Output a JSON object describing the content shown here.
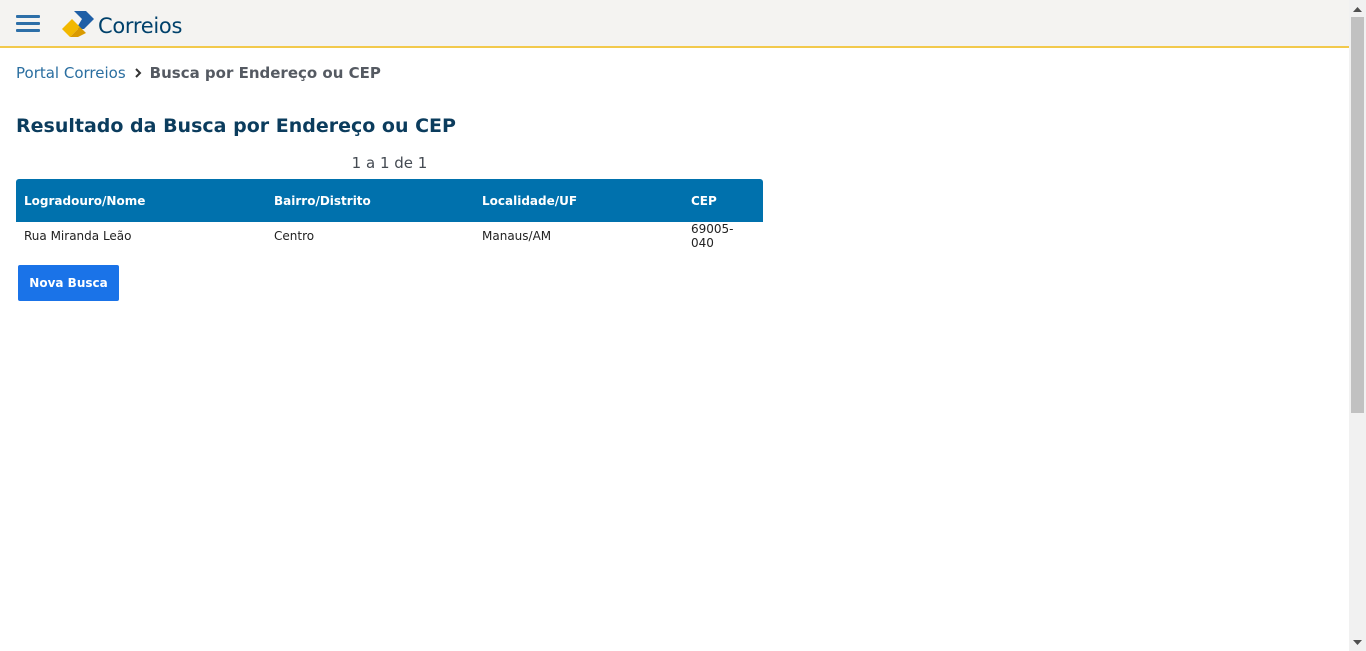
{
  "header": {
    "menu_icon": "hamburger-menu-icon",
    "logo_text": "Correios",
    "logo_icon": "correios-logo-mark",
    "accent_color": "#f2c94c",
    "brand_color": "#00416b"
  },
  "breadcrumb": {
    "home_label": "Portal Correios",
    "separator_icon": "chevron-right-icon",
    "current_label": "Busca por Endereço ou CEP"
  },
  "page": {
    "title": "Resultado da Busca por Endereço ou CEP",
    "pagination": "1 a 1 de 1"
  },
  "table": {
    "header_color": "#0071ad",
    "columns": [
      "Logradouro/Nome",
      "Bairro/Distrito",
      "Localidade/UF",
      "CEP"
    ],
    "rows": [
      [
        "Rua Miranda Leão",
        "Centro",
        "Manaus/AM",
        "69005-040"
      ]
    ]
  },
  "actions": {
    "new_search_label": "Nova Busca",
    "button_color": "#1a73e8"
  }
}
